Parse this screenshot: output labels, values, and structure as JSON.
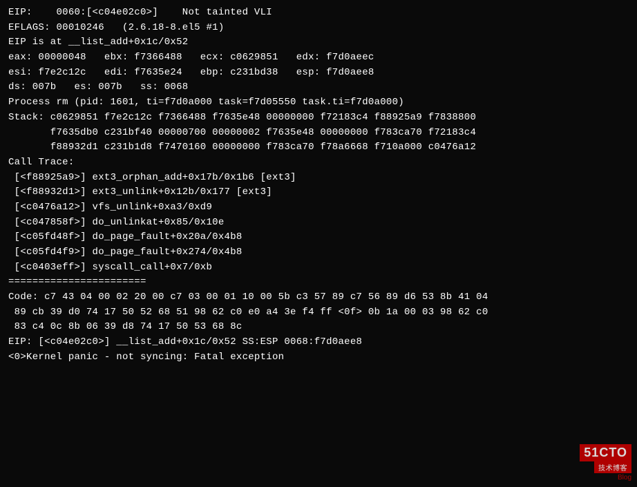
{
  "terminal": {
    "lines": [
      {
        "text": "EIP:    0060:[<c04e02c0>]    Not tainted VLI",
        "class": "bright"
      },
      {
        "text": "EFLAGS: 00010246   (2.6.18-8.el5 #1)",
        "class": "bright"
      },
      {
        "text": "EIP is at __list_add+0x1c/0x52",
        "class": "bright"
      },
      {
        "text": "eax: 00000048   ebx: f7366488   ecx: c0629851   edx: f7d0aeec",
        "class": "bright"
      },
      {
        "text": "esi: f7e2c12c   edi: f7635e24   ebp: c231bd38   esp: f7d0aee8",
        "class": "bright"
      },
      {
        "text": "ds: 007b   es: 007b   ss: 0068",
        "class": "bright"
      },
      {
        "text": "",
        "class": ""
      },
      {
        "text": "Process rm (pid: 1601, ti=f7d0a000 task=f7d05550 task.ti=f7d0a000)",
        "class": "bright"
      },
      {
        "text": "Stack: c0629851 f7e2c12c f7366488 f7635e48 00000000 f72183c4 f88925a9 f7838800",
        "class": "bright"
      },
      {
        "text": "       f7635db0 c231bf40 00000700 00000002 f7635e48 00000000 f783ca70 f72183c4",
        "class": "bright"
      },
      {
        "text": "       f88932d1 c231b1d8 f7470160 00000000 f783ca70 f78a6668 f710a000 c0476a12",
        "class": "bright"
      },
      {
        "text": "",
        "class": ""
      },
      {
        "text": "Call Trace:",
        "class": "bright"
      },
      {
        "text": " [<f88925a9>] ext3_orphan_add+0x17b/0x1b6 [ext3]",
        "class": "bright"
      },
      {
        "text": " [<f88932d1>] ext3_unlink+0x12b/0x177 [ext3]",
        "class": "bright"
      },
      {
        "text": " [<c0476a12>] vfs_unlink+0xa3/0xd9",
        "class": "bright"
      },
      {
        "text": " [<c047858f>] do_unlinkat+0x85/0x10e",
        "class": "bright"
      },
      {
        "text": " [<c05fd48f>] do_page_fault+0x20a/0x4b8",
        "class": "bright"
      },
      {
        "text": " [<c05fd4f9>] do_page_fault+0x274/0x4b8",
        "class": "bright"
      },
      {
        "text": " [<c0403eff>] syscall_call+0x7/0xb",
        "class": "bright"
      },
      {
        "text": "=======================",
        "class": "bright"
      },
      {
        "text": "Code: c7 43 04 00 02 20 00 c7 03 00 01 10 00 5b c3 57 89 c7 56 89 d6 53 8b 41 04",
        "class": "bright"
      },
      {
        "text": " 89 cb 39 d0 74 17 50 52 68 51 98 62 c0 e0 a4 3e f4 ff <0f> 0b 1a 00 03 98 62 c0",
        "class": "bright"
      },
      {
        "text": " 83 c4 0c 8b 06 39 d8 74 17 50 53 68 8c",
        "class": "bright"
      },
      {
        "text": "EIP: [<c04e02c0>] __list_add+0x1c/0x52 SS:ESP 0068:f7d0aee8",
        "class": "bright"
      },
      {
        "text": "<0>Kernel panic - not syncing: Fatal exception",
        "class": "bright"
      }
    ]
  },
  "watermark": {
    "brand": "51CTO",
    "sub1": "技术博客",
    "sub2": "Blog"
  }
}
